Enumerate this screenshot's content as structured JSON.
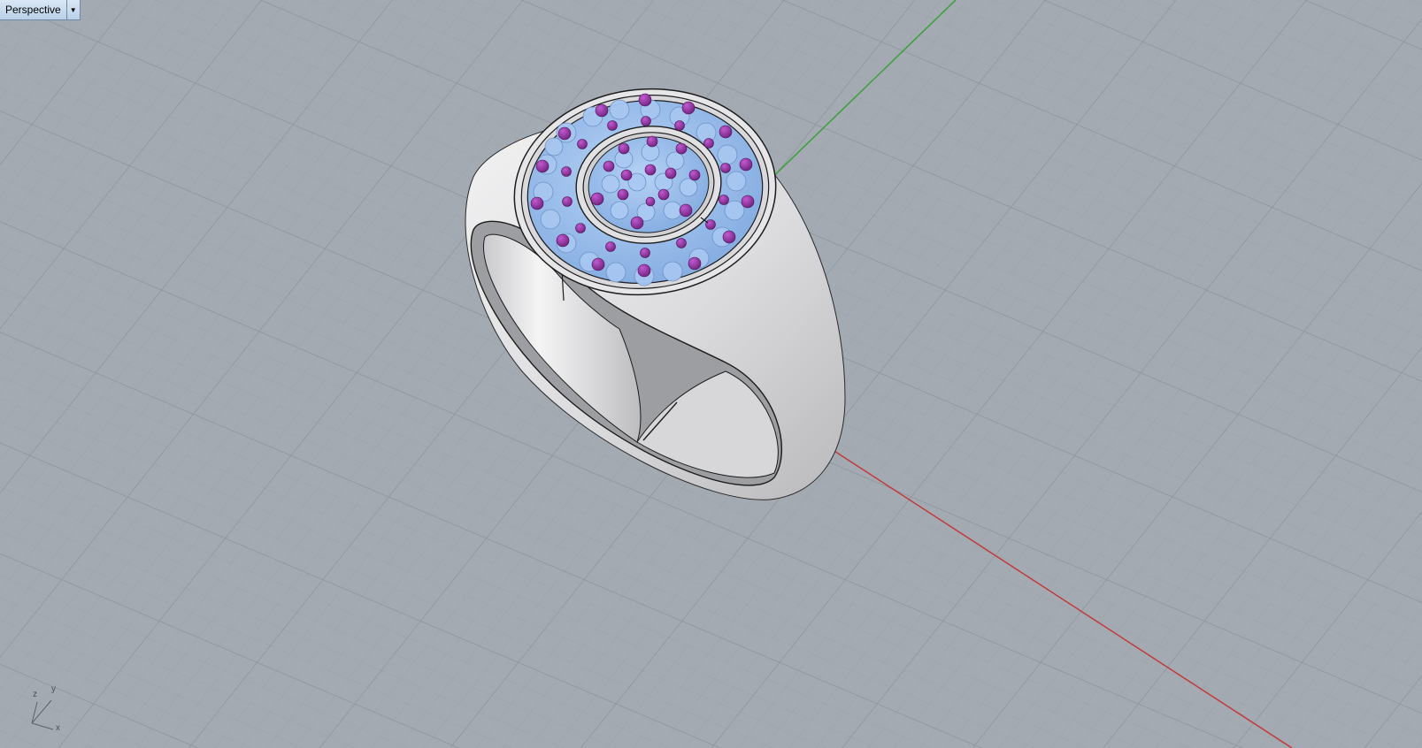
{
  "viewport": {
    "title": "Perspective",
    "dropdown_icon": "triangle-down-icon",
    "background_color": "#a3aab2",
    "grid_color_minor": "#9aa1a9",
    "grid_color_major": "#8b929a"
  },
  "scene": {
    "axes": {
      "x_color": "#c23a3a",
      "y_color": "#3aa03a"
    },
    "ring": {
      "metal_color": "#e4e4e6",
      "pave_color": "#9ec2ef",
      "prong_color": "#8a2e96"
    }
  },
  "axis_indicator": {
    "z": "z",
    "y": "y",
    "x": "x"
  }
}
